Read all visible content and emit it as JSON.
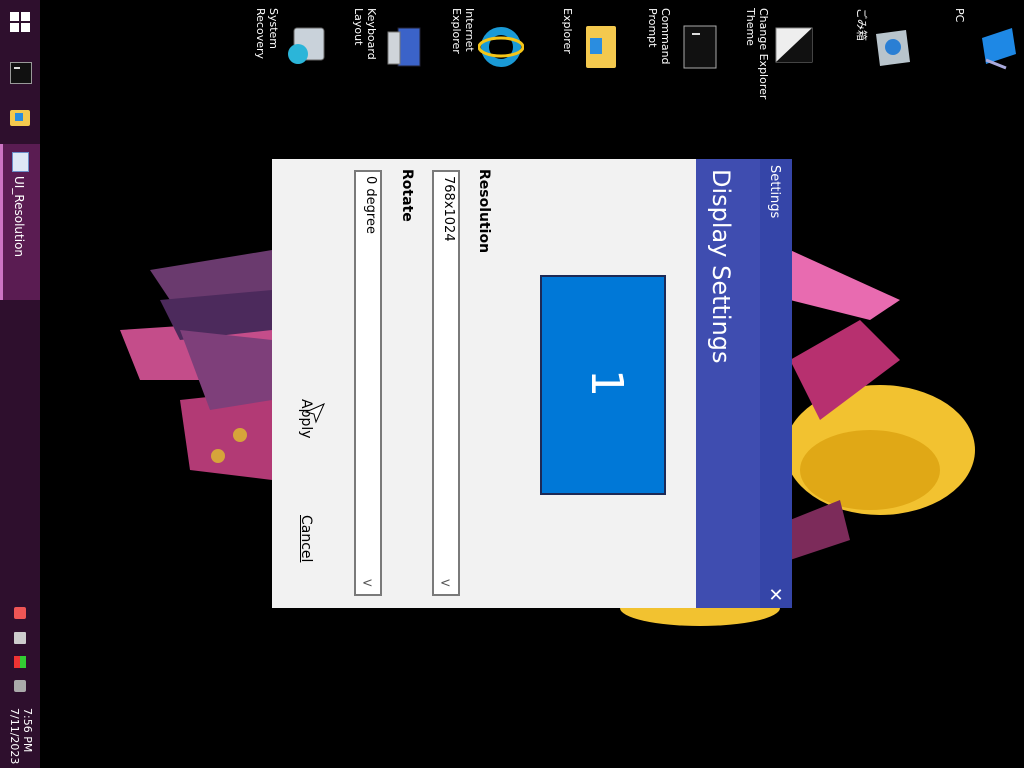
{
  "taskbar": {
    "active_app_label": "UI_Resolution",
    "time": "7:56 PM",
    "date": "7/11/2023",
    "icons": [
      "windows-start-icon",
      "command-prompt-icon",
      "file-explorer-icon",
      "ui-resolution-app-icon",
      "network-icon",
      "keyboard-icon",
      "color-icon",
      "volume-muted-icon"
    ]
  },
  "desktop": {
    "icons": [
      {
        "label": "PC",
        "icon": "pc-icon"
      },
      {
        "label": "ごみ箱",
        "icon": "recycle-bin-icon"
      },
      {
        "label": "Change Explorer Theme",
        "icon": "theme-icon"
      },
      {
        "label": "Command Prompt",
        "icon": "command-prompt-icon"
      },
      {
        "label": "Explorer",
        "icon": "folder-icon"
      },
      {
        "label": "Internet Explorer",
        "icon": "internet-explorer-icon"
      },
      {
        "label": "Keyboard Layout",
        "icon": "keyboard-icon"
      },
      {
        "label": "System Recovery",
        "icon": "system-recovery-icon"
      }
    ]
  },
  "dialog": {
    "window_title": "Settings",
    "heading": "Display Settings",
    "monitor_number": "1",
    "resolution_label": "Resolution",
    "resolution_value": "768x1024",
    "rotate_label": "Rotate",
    "rotate_value": "0 degree",
    "apply_label": "Apply",
    "cancel_label": "Cancel",
    "accent_color": "#3f4db0",
    "monitor_color": "#0078d7"
  }
}
